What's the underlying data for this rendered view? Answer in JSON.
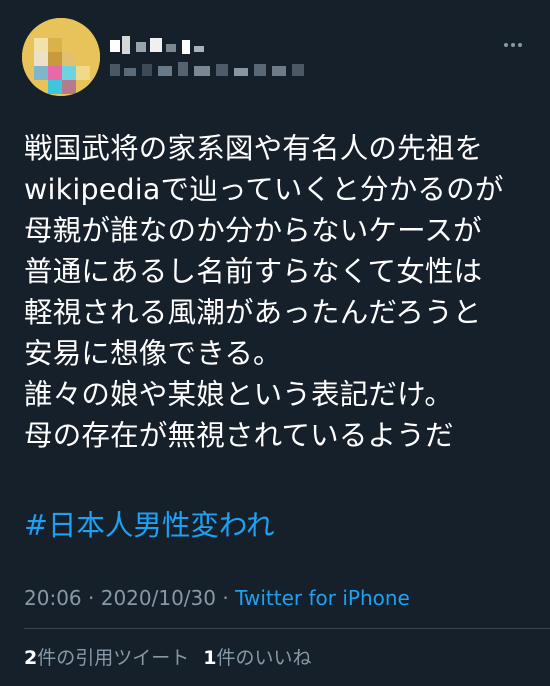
{
  "tweet": {
    "lines": [
      "戦国武将の家系図や有名人の先祖を",
      "wikipediaで辿っていくと分かるのが",
      "母親が誰なのか分からないケースが",
      "普通にあるし名前すらなくて女性は",
      "軽視される風潮があったんだろうと",
      "安易に想像できる。",
      "誰々の娘や某娘という表記だけ。",
      "母の存在が無視されているようだ"
    ],
    "hashtag": "#日本人男性変われ",
    "time": "20:06",
    "separator1": " · ",
    "date": "2020/10/30",
    "separator2": " · ",
    "source": "Twitter for iPhone"
  },
  "stats": {
    "retweet_count": "2",
    "retweet_label": "件の引用ツイート",
    "like_count": "1",
    "like_label": "件のいいね"
  },
  "icons": {
    "more": "more-horizontal-icon",
    "avatar": "user-avatar-pixelated"
  },
  "colors": {
    "background": "#15202b",
    "text": "#ffffff",
    "secondary": "#8899a6",
    "link": "#1da1f2",
    "divider": "#38444d"
  }
}
